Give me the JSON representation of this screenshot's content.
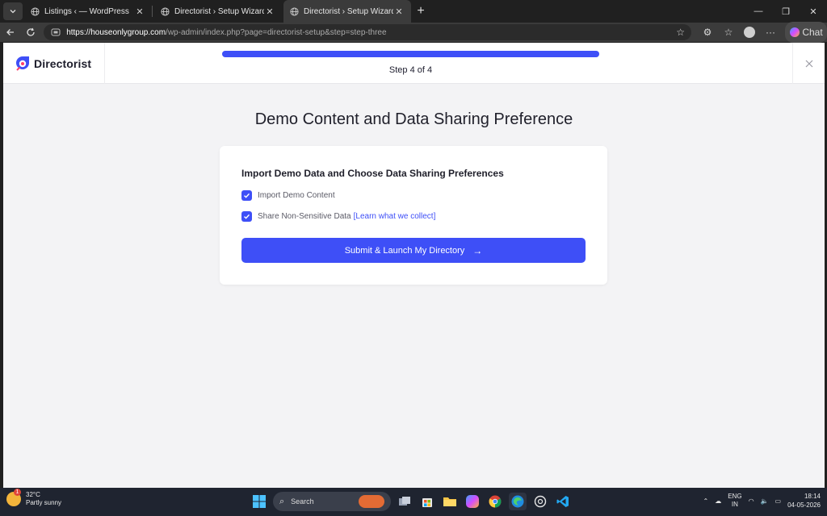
{
  "browser": {
    "tabs": [
      {
        "title": "Listings ‹ — WordPress",
        "active": false
      },
      {
        "title": "Directorist › Setup Wizard",
        "active": false
      },
      {
        "title": "Directorist › Setup Wizard",
        "active": true
      }
    ],
    "url_host": "https://houseonlygroup.com",
    "url_path": "/wp-admin/index.php?page=directorist-setup&step=step-three",
    "chat_label": "Chat"
  },
  "wizard": {
    "brand": "Directorist",
    "progress_fraction": 1.0,
    "step_text": "Step 4 of 4",
    "title": "Demo Content and Data Sharing Preference",
    "card_title": "Import Demo Data and Choose Data Sharing Preferences",
    "options": [
      {
        "label": "Import Demo Content",
        "checked": true
      },
      {
        "label": "Share Non-Sensitive Data",
        "checked": true,
        "link": "[Learn what we collect]"
      }
    ],
    "submit_label": "Submit & Launch My Directory",
    "accent": "#3e4ff7"
  },
  "taskbar": {
    "temp": "32°C",
    "weather": "Partly sunny",
    "weather_badge": "1",
    "search_placeholder": "Search",
    "lang_line1": "ENG",
    "lang_line2": "IN",
    "time": "18:14",
    "date": "04-05-2026"
  }
}
